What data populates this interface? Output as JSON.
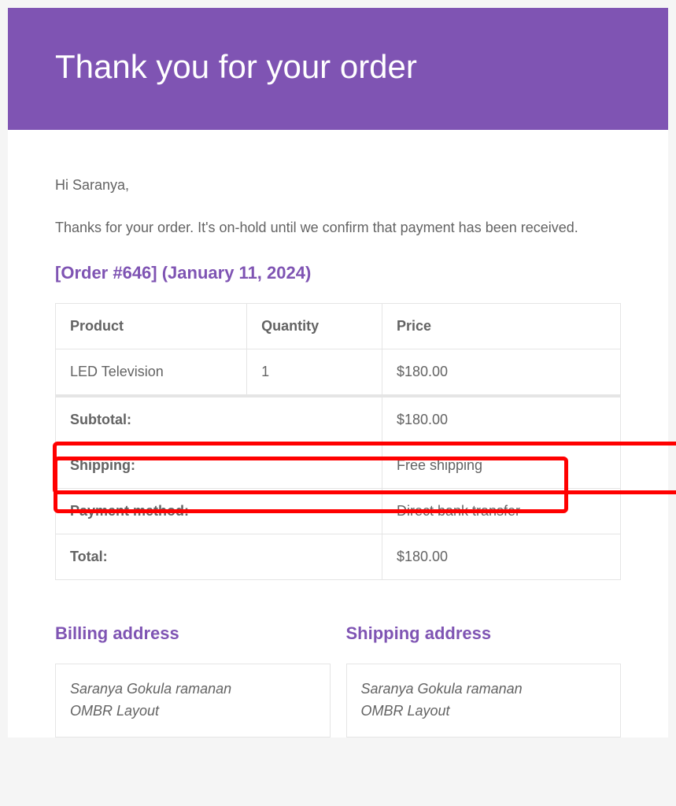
{
  "header": {
    "title": "Thank you for your order"
  },
  "body": {
    "greeting": "Hi Saranya,",
    "intro": "Thanks for your order. It's on-hold until we confirm that payment has been received.",
    "order_heading": "[Order #646] (January 11, 2024)"
  },
  "table": {
    "headers": {
      "product": "Product",
      "quantity": "Quantity",
      "price": "Price"
    },
    "items": [
      {
        "product": "LED Television",
        "quantity": "1",
        "price": "$180.00"
      }
    ],
    "summary": {
      "subtotal_label": "Subtotal:",
      "subtotal_value": "$180.00",
      "shipping_label": "Shipping:",
      "shipping_value": "Free shipping",
      "payment_label": "Payment method:",
      "payment_value": "Direct bank transfer",
      "total_label": "Total:",
      "total_value": "$180.00"
    }
  },
  "addresses": {
    "billing_heading": "Billing address",
    "shipping_heading": "Shipping address",
    "billing": {
      "name": "Saranya Gokula ramanan",
      "line1": "OMBR Layout"
    },
    "shipping": {
      "name": "Saranya Gokula ramanan",
      "line1": "OMBR Layout"
    }
  }
}
